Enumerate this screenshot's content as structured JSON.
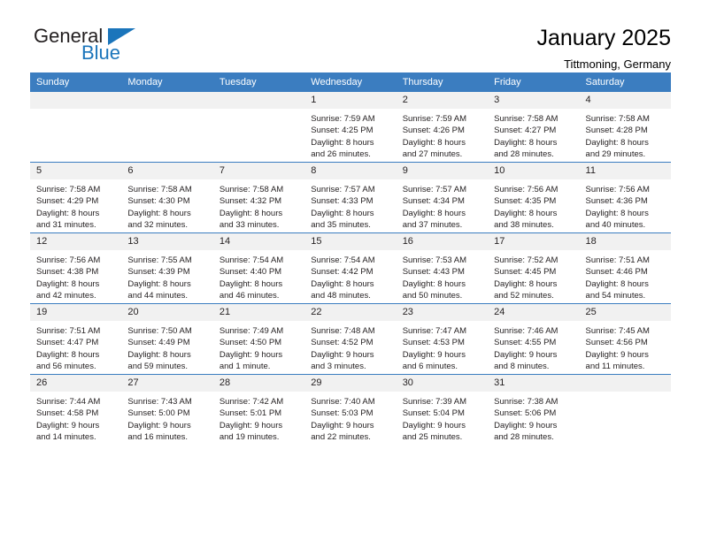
{
  "logo": {
    "word_top": "General",
    "word_bottom": "Blue",
    "accent_color": "#1b75bb",
    "triangle_icon": "triangle-icon"
  },
  "header": {
    "title": "January 2025",
    "subtitle": "Tittmoning, Germany"
  },
  "theme": {
    "header_blue": "#3b7dc0",
    "date_band_gray": "#f1f1f1",
    "text_color": "#231f20"
  },
  "calendar": {
    "weekday_headers": [
      "Sunday",
      "Monday",
      "Tuesday",
      "Wednesday",
      "Thursday",
      "Friday",
      "Saturday"
    ],
    "weeks": [
      [
        {
          "day": "",
          "empty": true,
          "sunrise": "",
          "sunset": "",
          "daylight1": "",
          "daylight2": ""
        },
        {
          "day": "",
          "empty": true,
          "sunrise": "",
          "sunset": "",
          "daylight1": "",
          "daylight2": ""
        },
        {
          "day": "",
          "empty": true,
          "sunrise": "",
          "sunset": "",
          "daylight1": "",
          "daylight2": ""
        },
        {
          "day": "1",
          "empty": false,
          "sunrise": "Sunrise: 7:59 AM",
          "sunset": "Sunset: 4:25 PM",
          "daylight1": "Daylight: 8 hours",
          "daylight2": "and 26 minutes."
        },
        {
          "day": "2",
          "empty": false,
          "sunrise": "Sunrise: 7:59 AM",
          "sunset": "Sunset: 4:26 PM",
          "daylight1": "Daylight: 8 hours",
          "daylight2": "and 27 minutes."
        },
        {
          "day": "3",
          "empty": false,
          "sunrise": "Sunrise: 7:58 AM",
          "sunset": "Sunset: 4:27 PM",
          "daylight1": "Daylight: 8 hours",
          "daylight2": "and 28 minutes."
        },
        {
          "day": "4",
          "empty": false,
          "sunrise": "Sunrise: 7:58 AM",
          "sunset": "Sunset: 4:28 PM",
          "daylight1": "Daylight: 8 hours",
          "daylight2": "and 29 minutes."
        }
      ],
      [
        {
          "day": "5",
          "empty": false,
          "sunrise": "Sunrise: 7:58 AM",
          "sunset": "Sunset: 4:29 PM",
          "daylight1": "Daylight: 8 hours",
          "daylight2": "and 31 minutes."
        },
        {
          "day": "6",
          "empty": false,
          "sunrise": "Sunrise: 7:58 AM",
          "sunset": "Sunset: 4:30 PM",
          "daylight1": "Daylight: 8 hours",
          "daylight2": "and 32 minutes."
        },
        {
          "day": "7",
          "empty": false,
          "sunrise": "Sunrise: 7:58 AM",
          "sunset": "Sunset: 4:32 PM",
          "daylight1": "Daylight: 8 hours",
          "daylight2": "and 33 minutes."
        },
        {
          "day": "8",
          "empty": false,
          "sunrise": "Sunrise: 7:57 AM",
          "sunset": "Sunset: 4:33 PM",
          "daylight1": "Daylight: 8 hours",
          "daylight2": "and 35 minutes."
        },
        {
          "day": "9",
          "empty": false,
          "sunrise": "Sunrise: 7:57 AM",
          "sunset": "Sunset: 4:34 PM",
          "daylight1": "Daylight: 8 hours",
          "daylight2": "and 37 minutes."
        },
        {
          "day": "10",
          "empty": false,
          "sunrise": "Sunrise: 7:56 AM",
          "sunset": "Sunset: 4:35 PM",
          "daylight1": "Daylight: 8 hours",
          "daylight2": "and 38 minutes."
        },
        {
          "day": "11",
          "empty": false,
          "sunrise": "Sunrise: 7:56 AM",
          "sunset": "Sunset: 4:36 PM",
          "daylight1": "Daylight: 8 hours",
          "daylight2": "and 40 minutes."
        }
      ],
      [
        {
          "day": "12",
          "empty": false,
          "sunrise": "Sunrise: 7:56 AM",
          "sunset": "Sunset: 4:38 PM",
          "daylight1": "Daylight: 8 hours",
          "daylight2": "and 42 minutes."
        },
        {
          "day": "13",
          "empty": false,
          "sunrise": "Sunrise: 7:55 AM",
          "sunset": "Sunset: 4:39 PM",
          "daylight1": "Daylight: 8 hours",
          "daylight2": "and 44 minutes."
        },
        {
          "day": "14",
          "empty": false,
          "sunrise": "Sunrise: 7:54 AM",
          "sunset": "Sunset: 4:40 PM",
          "daylight1": "Daylight: 8 hours",
          "daylight2": "and 46 minutes."
        },
        {
          "day": "15",
          "empty": false,
          "sunrise": "Sunrise: 7:54 AM",
          "sunset": "Sunset: 4:42 PM",
          "daylight1": "Daylight: 8 hours",
          "daylight2": "and 48 minutes."
        },
        {
          "day": "16",
          "empty": false,
          "sunrise": "Sunrise: 7:53 AM",
          "sunset": "Sunset: 4:43 PM",
          "daylight1": "Daylight: 8 hours",
          "daylight2": "and 50 minutes."
        },
        {
          "day": "17",
          "empty": false,
          "sunrise": "Sunrise: 7:52 AM",
          "sunset": "Sunset: 4:45 PM",
          "daylight1": "Daylight: 8 hours",
          "daylight2": "and 52 minutes."
        },
        {
          "day": "18",
          "empty": false,
          "sunrise": "Sunrise: 7:51 AM",
          "sunset": "Sunset: 4:46 PM",
          "daylight1": "Daylight: 8 hours",
          "daylight2": "and 54 minutes."
        }
      ],
      [
        {
          "day": "19",
          "empty": false,
          "sunrise": "Sunrise: 7:51 AM",
          "sunset": "Sunset: 4:47 PM",
          "daylight1": "Daylight: 8 hours",
          "daylight2": "and 56 minutes."
        },
        {
          "day": "20",
          "empty": false,
          "sunrise": "Sunrise: 7:50 AM",
          "sunset": "Sunset: 4:49 PM",
          "daylight1": "Daylight: 8 hours",
          "daylight2": "and 59 minutes."
        },
        {
          "day": "21",
          "empty": false,
          "sunrise": "Sunrise: 7:49 AM",
          "sunset": "Sunset: 4:50 PM",
          "daylight1": "Daylight: 9 hours",
          "daylight2": "and 1 minute."
        },
        {
          "day": "22",
          "empty": false,
          "sunrise": "Sunrise: 7:48 AM",
          "sunset": "Sunset: 4:52 PM",
          "daylight1": "Daylight: 9 hours",
          "daylight2": "and 3 minutes."
        },
        {
          "day": "23",
          "empty": false,
          "sunrise": "Sunrise: 7:47 AM",
          "sunset": "Sunset: 4:53 PM",
          "daylight1": "Daylight: 9 hours",
          "daylight2": "and 6 minutes."
        },
        {
          "day": "24",
          "empty": false,
          "sunrise": "Sunrise: 7:46 AM",
          "sunset": "Sunset: 4:55 PM",
          "daylight1": "Daylight: 9 hours",
          "daylight2": "and 8 minutes."
        },
        {
          "day": "25",
          "empty": false,
          "sunrise": "Sunrise: 7:45 AM",
          "sunset": "Sunset: 4:56 PM",
          "daylight1": "Daylight: 9 hours",
          "daylight2": "and 11 minutes."
        }
      ],
      [
        {
          "day": "26",
          "empty": false,
          "sunrise": "Sunrise: 7:44 AM",
          "sunset": "Sunset: 4:58 PM",
          "daylight1": "Daylight: 9 hours",
          "daylight2": "and 14 minutes."
        },
        {
          "day": "27",
          "empty": false,
          "sunrise": "Sunrise: 7:43 AM",
          "sunset": "Sunset: 5:00 PM",
          "daylight1": "Daylight: 9 hours",
          "daylight2": "and 16 minutes."
        },
        {
          "day": "28",
          "empty": false,
          "sunrise": "Sunrise: 7:42 AM",
          "sunset": "Sunset: 5:01 PM",
          "daylight1": "Daylight: 9 hours",
          "daylight2": "and 19 minutes."
        },
        {
          "day": "29",
          "empty": false,
          "sunrise": "Sunrise: 7:40 AM",
          "sunset": "Sunset: 5:03 PM",
          "daylight1": "Daylight: 9 hours",
          "daylight2": "and 22 minutes."
        },
        {
          "day": "30",
          "empty": false,
          "sunrise": "Sunrise: 7:39 AM",
          "sunset": "Sunset: 5:04 PM",
          "daylight1": "Daylight: 9 hours",
          "daylight2": "and 25 minutes."
        },
        {
          "day": "31",
          "empty": false,
          "sunrise": "Sunrise: 7:38 AM",
          "sunset": "Sunset: 5:06 PM",
          "daylight1": "Daylight: 9 hours",
          "daylight2": "and 28 minutes."
        },
        {
          "day": "",
          "empty": true,
          "sunrise": "",
          "sunset": "",
          "daylight1": "",
          "daylight2": ""
        }
      ]
    ]
  }
}
